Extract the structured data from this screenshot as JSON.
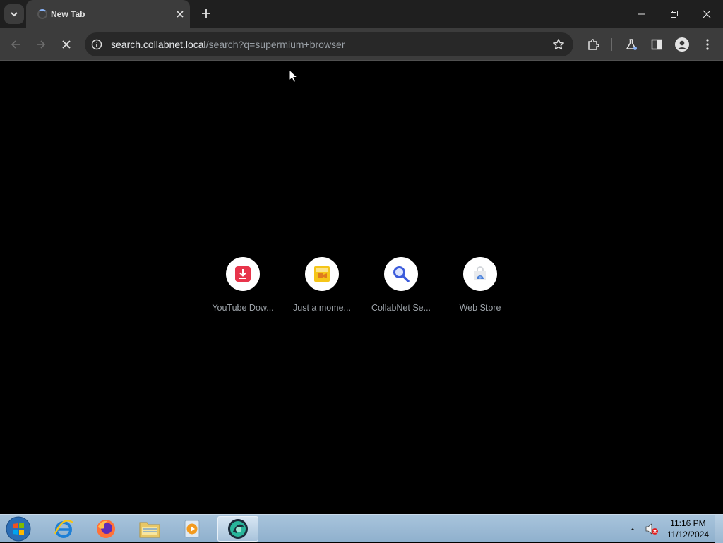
{
  "tab": {
    "title": "New Tab"
  },
  "omnibox": {
    "host": "search.collabnet.local",
    "path": "/search?q=supermium+browser"
  },
  "shortcuts": [
    {
      "label": "YouTube Dow...",
      "icon": "download-icon"
    },
    {
      "label": "Just a mome...",
      "icon": "folder-image-icon"
    },
    {
      "label": "CollabNet Se...",
      "icon": "search-icon"
    },
    {
      "label": "Web Store",
      "icon": "web-store-icon"
    }
  ],
  "clock": {
    "time": "11:16 PM",
    "date": "11/12/2024"
  },
  "colors": {
    "accent": "#8ab4f8",
    "shortcut_download": "#e8344b",
    "shortcut_search": "#3b5bdb"
  }
}
